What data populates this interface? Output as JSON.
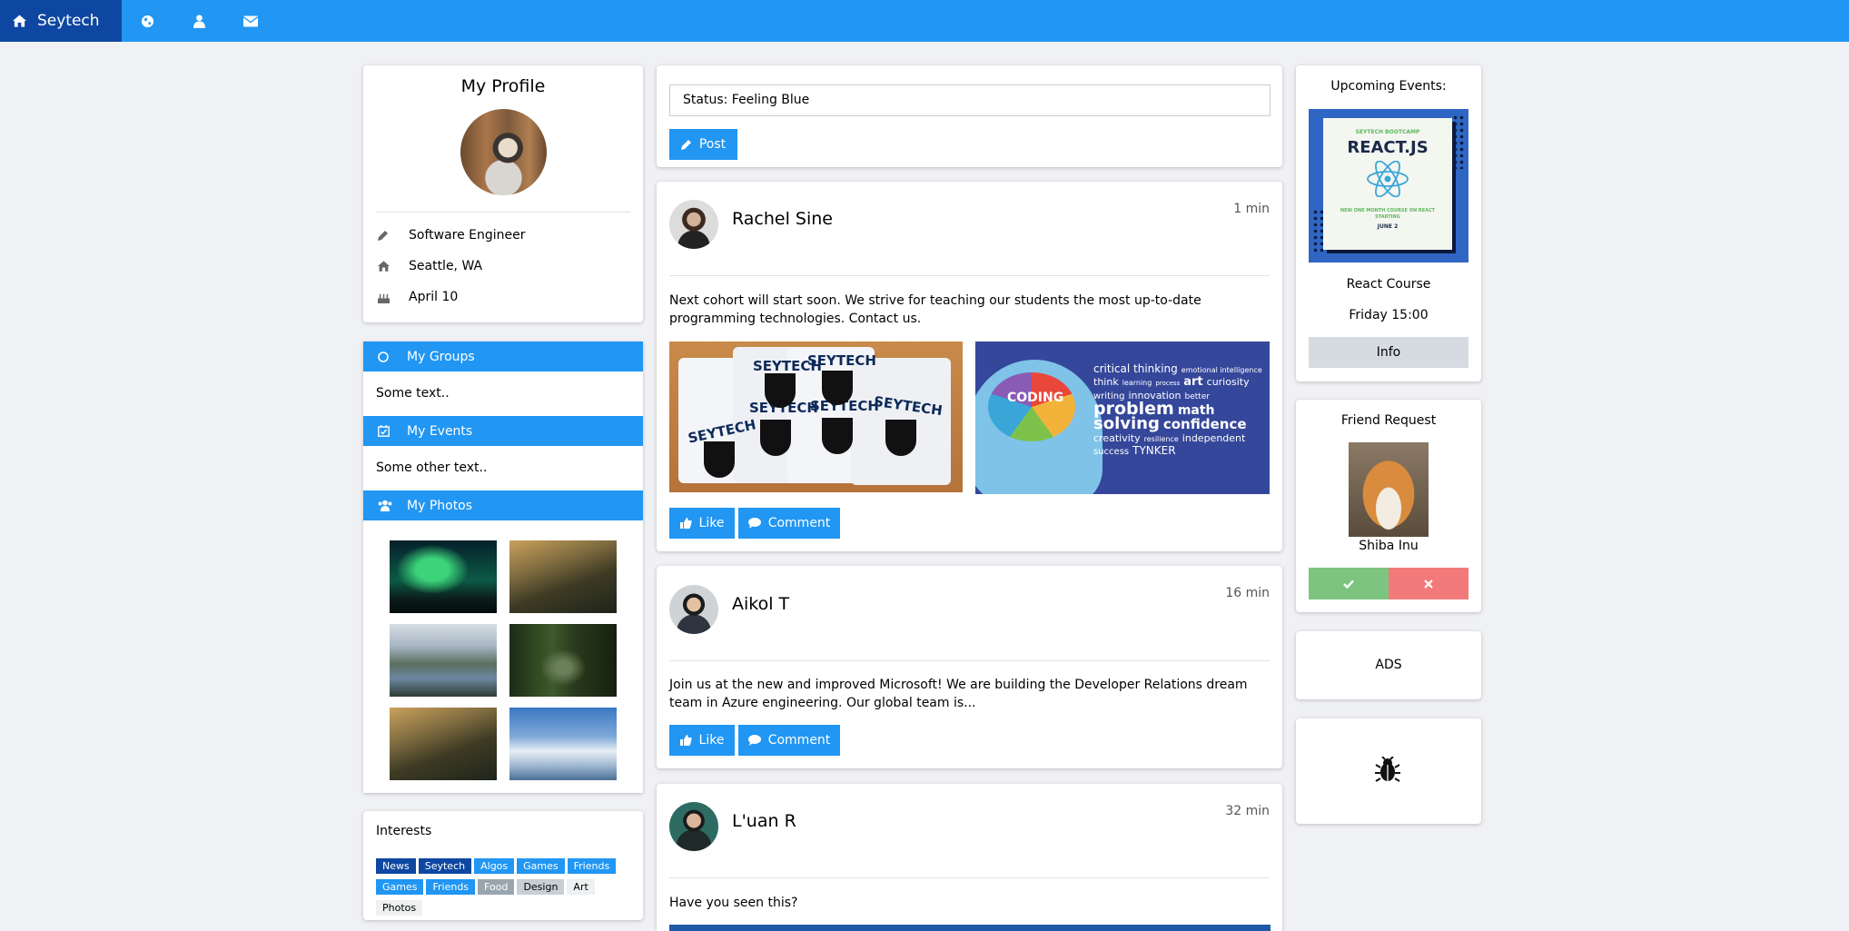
{
  "nav": {
    "brand": "Seytech",
    "icons": [
      "globe-icon",
      "user-icon",
      "envelope-icon"
    ]
  },
  "profile": {
    "title": "My Profile",
    "job": "Software Engineer",
    "location": "Seattle, WA",
    "birthday": "April 10"
  },
  "accordion": {
    "groups_label": "My Groups",
    "groups_text": "Some text..",
    "events_label": "My Events",
    "events_text": "Some other text..",
    "photos_label": "My Photos"
  },
  "interests": {
    "title": "Interests",
    "tags": [
      {
        "label": "News",
        "color": "#0d47a1"
      },
      {
        "label": "Seytech",
        "color": "#0d47a1"
      },
      {
        "label": "Algos",
        "color": "#2196f3"
      },
      {
        "label": "Games",
        "color": "#2196f3"
      },
      {
        "label": "Friends",
        "color": "#2196f3"
      },
      {
        "label": "Games",
        "color": "#2196f3"
      },
      {
        "label": "Friends",
        "color": "#2196f3"
      },
      {
        "label": "Food",
        "color": "#9aa5ae"
      },
      {
        "label": "Design",
        "color": "#c7ced4"
      },
      {
        "label": "Art",
        "color": "#eef0f2"
      },
      {
        "label": "Photos",
        "color": "#eef0f2"
      }
    ]
  },
  "status": {
    "value": "Status: Feeling Blue",
    "post_label": "Post"
  },
  "posts": [
    {
      "name": "Rachel Sine",
      "time": "1 min",
      "text": "Next cohort will start soon. We strive for teaching our students the most up-to-date programming technologies. Contact us.",
      "like": "Like",
      "comment": "Comment"
    },
    {
      "name": "Aikol T",
      "time": "16 min",
      "text": "Join us at the new and improved Microsoft! We are building the Developer Relations dream team in Azure engineering. Our global team is...",
      "like": "Like",
      "comment": "Comment"
    },
    {
      "name": "L'uan R",
      "time": "32 min",
      "text": "Have you seen this?"
    }
  ],
  "post_image_text": {
    "shirt": "SEYTECH",
    "coding": "CODING",
    "words": [
      "critical thinking",
      "emotional intelligence",
      "think",
      "learning",
      "process",
      "art",
      "curiosity",
      "writing",
      "innovation",
      "better",
      "problem",
      "math",
      "solving",
      "confidence",
      "creativity",
      "resilience",
      "independent",
      "success",
      "TYNKER"
    ]
  },
  "events": {
    "title": "Upcoming Events:",
    "poster_top": "SEYTECH BOOTCAMP",
    "poster_title": "REACT.JS",
    "poster_sub": "NEW ONE MONTH COURSE ON REACT STARTING",
    "poster_date": "JUNE 2",
    "name": "React Course",
    "when": "Friday 15:00",
    "info_label": "Info"
  },
  "friend": {
    "title": "Friend Request",
    "name": "Shiba Inu"
  },
  "ads": {
    "label": "ADS"
  }
}
